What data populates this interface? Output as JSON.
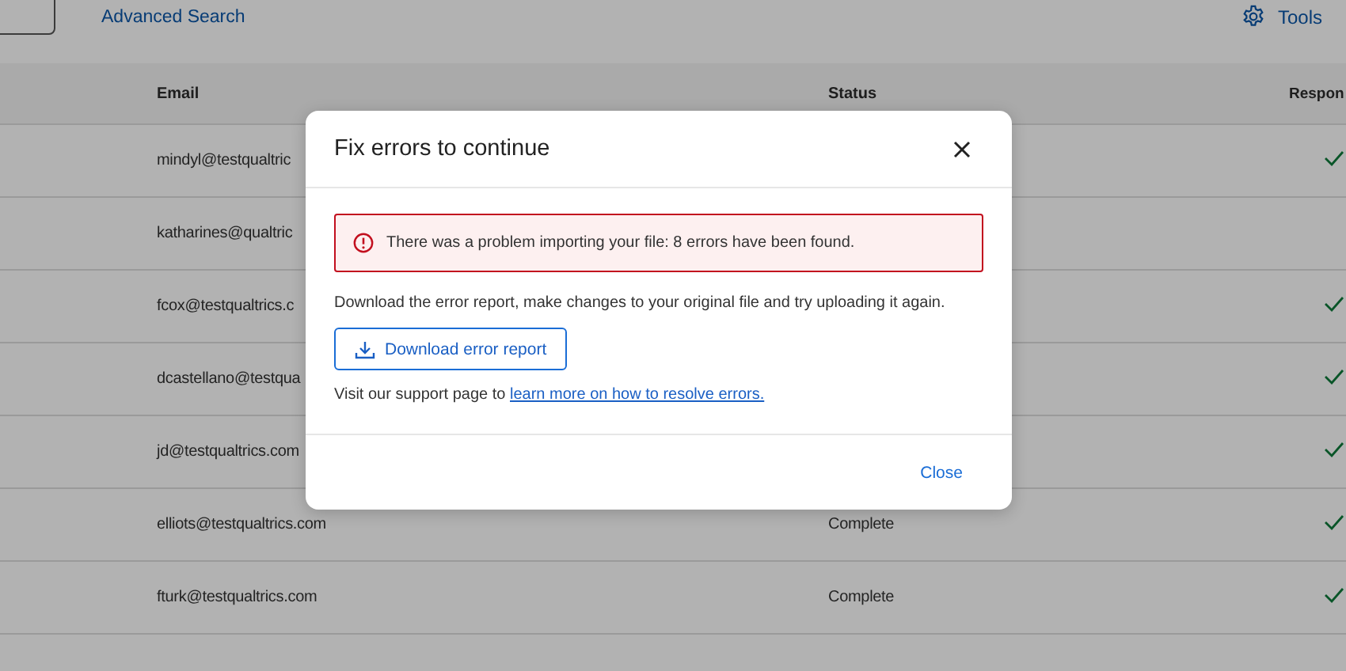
{
  "toolbar": {
    "advanced_search": "Advanced Search",
    "tools": "Tools"
  },
  "table": {
    "columns": [
      "Email",
      "Status",
      "Respon"
    ],
    "rows": [
      {
        "email": "mindyl@testqualtric",
        "responded": true
      },
      {
        "email": "katharines@qualtric",
        "responded": false
      },
      {
        "email": "fcox@testqualtrics.c",
        "responded": true
      },
      {
        "email": "dcastellano@testqua",
        "responded": true
      },
      {
        "email": "jd@testqualtrics.com",
        "responded": true
      },
      {
        "email": "elliots@testqualtrics.com",
        "status": "Complete",
        "responded": true
      },
      {
        "email": "fturk@testqualtrics.com",
        "status": "Complete",
        "responded": true
      }
    ]
  },
  "dialog": {
    "title": "Fix errors to continue",
    "error": "There was a problem importing your file: 8 errors have been found.",
    "instructions": "Download the error report, make changes to your original file and try uploading it again.",
    "download_button": "Download error report",
    "support_text": "Visit our support page to",
    "support_link": "learn more on how to resolve errors.",
    "close_button": "Close"
  }
}
